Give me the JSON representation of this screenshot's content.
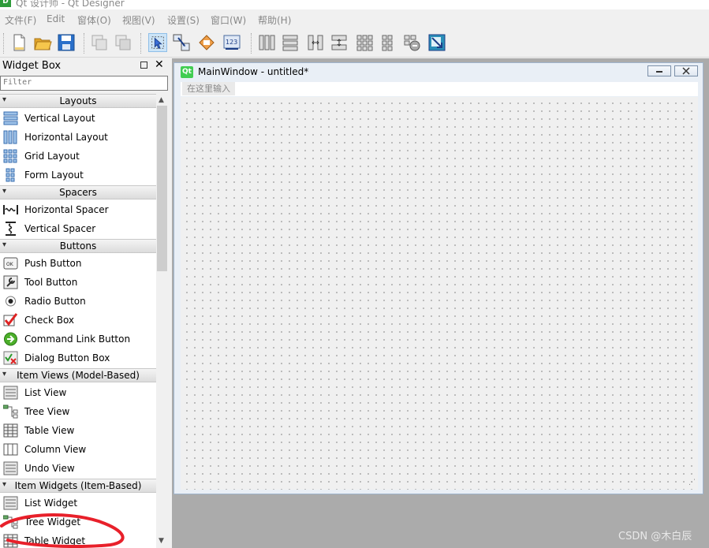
{
  "window": {
    "title": "Qt 设计师 - Qt Designer",
    "app_icon_text": "D"
  },
  "menubar": [
    "文件(F)",
    "Edit",
    "窗体(O)",
    "视图(V)",
    "设置(S)",
    "窗口(W)",
    "帮助(H)"
  ],
  "toolbar_icons": [
    "new-file-icon",
    "open-folder-icon",
    "save-icon",
    "copy-icon",
    "paste-icon",
    "edit-widgets-icon",
    "edit-signals-icon",
    "edit-buddies-icon",
    "edit-tab-order-icon",
    "layout-horizontal-icon",
    "layout-vertical-icon",
    "layout-horizontal-splitter-icon",
    "layout-vertical-splitter-icon",
    "layout-grid-icon",
    "layout-form-icon",
    "break-layout-icon",
    "adjust-size-icon"
  ],
  "widget_box": {
    "title": "Widget Box",
    "filter_placeholder": "Filter",
    "categories": [
      {
        "label": "Layouts",
        "items": [
          "Vertical Layout",
          "Horizontal Layout",
          "Grid Layout",
          "Form Layout"
        ]
      },
      {
        "label": "Spacers",
        "items": [
          "Horizontal Spacer",
          "Vertical Spacer"
        ]
      },
      {
        "label": "Buttons",
        "items": [
          "Push Button",
          "Tool Button",
          "Radio Button",
          "Check Box",
          "Command Link Button",
          "Dialog Button Box"
        ]
      },
      {
        "label": "Item Views (Model-Based)",
        "items": [
          "List View",
          "Tree View",
          "Table View",
          "Column View",
          "Undo View"
        ]
      },
      {
        "label": "Item Widgets (Item-Based)",
        "items": [
          "List Widget",
          "Tree Widget",
          "Table Widget"
        ]
      }
    ]
  },
  "form": {
    "title": "MainWindow - untitled*",
    "qt_badge": "Qt",
    "menu_placeholder": "在这里输入"
  },
  "watermark": "CSDN @木白辰",
  "colors": {
    "accent": "#cce4f7",
    "highlight_stroke": "#e8202a",
    "qt_green": "#41cd52"
  }
}
